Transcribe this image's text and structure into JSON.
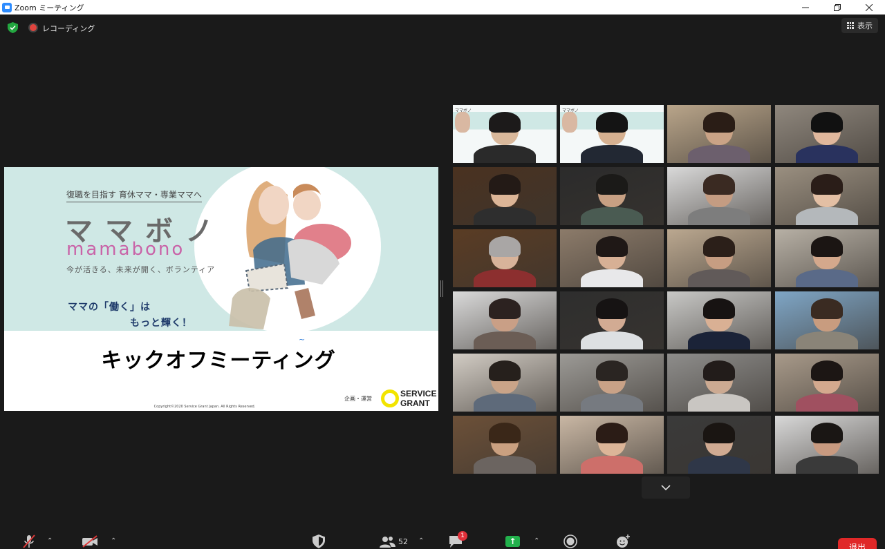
{
  "window": {
    "title": "Zoom ミーティング",
    "controls": [
      "minimize",
      "restore",
      "close"
    ]
  },
  "topbar": {
    "recording_label": "レコーディング",
    "view_label": "表示"
  },
  "slide": {
    "subheading": "復職を目指す 育休ママ・専業ママへ",
    "title_jp": "ママボノ",
    "title_en": "mamabono",
    "tagline": "今が活きる、未来が開く、ボランティア",
    "catch_line1": "ママの「働く」は",
    "catch_line2": "もっと輝く！",
    "main_title": "キックオフミーティング",
    "title_mark": "~",
    "organizer": "企画・運営",
    "logo_line1": "SERVICE",
    "logo_line2": "GRANT",
    "copyright": "Copyright©2020 Service Grant Japan. All Rights Reserved.",
    "corner_label": "ママボノ"
  },
  "participants": {
    "tiles": [
      {
        "bg": "#f4f8f8",
        "skin": "#d9b89b",
        "hair": "#1c1a1a",
        "shirt": "#2a2a2a",
        "branded": true
      },
      {
        "bg": "#f4f8f8",
        "skin": "#d6b191",
        "hair": "#141414",
        "shirt": "#222833",
        "branded": true,
        "active": true
      },
      {
        "bg": "#b9a58a",
        "skin": "#caa386",
        "hair": "#2a1d16",
        "shirt": "#6c5f6d"
      },
      {
        "bg": "#8f877d",
        "skin": "#e0b79c",
        "hair": "#111111",
        "shirt": "#29325e"
      },
      {
        "bg": "#4a3220",
        "skin": "#dcb597",
        "hair": "#231a16",
        "shirt": "#2e2e2e"
      },
      {
        "bg": "#2b2b2b",
        "skin": "#c7a083",
        "hair": "#1b1a18",
        "shirt": "#4a5b52"
      },
      {
        "bg": "#d9d9d9",
        "skin": "#c49c82",
        "hair": "#3a2a22",
        "shirt": "#7d7d7d"
      },
      {
        "bg": "#9a8f80",
        "skin": "#e3bfa4",
        "hair": "#2a1d18",
        "shirt": "#b4b8bb"
      },
      {
        "bg": "#5a3c24",
        "skin": "#d8b39a",
        "hair": "#a9a6a5",
        "shirt": "#8c2f2f"
      },
      {
        "bg": "#8c7b6a",
        "skin": "#d7b095",
        "hair": "#1f1816",
        "shirt": "#e8e8ea"
      },
      {
        "bg": "#bba890",
        "skin": "#c69d82",
        "hair": "#2b1f19",
        "shirt": "#615a59"
      },
      {
        "bg": "#b7b0a5",
        "skin": "#d4a88c",
        "hair": "#1b1513",
        "shirt": "#5a6a88"
      },
      {
        "bg": "#dadada",
        "skin": "#c99f86",
        "hair": "#2c2220",
        "shirt": "#6b5d55"
      },
      {
        "bg": "#2e2e2e",
        "skin": "#d2ab93",
        "hair": "#161313",
        "shirt": "#dde0e2"
      },
      {
        "bg": "#c8c8c6",
        "skin": "#d9b094",
        "hair": "#171312",
        "shirt": "#1b2338"
      },
      {
        "bg": "#7fa6c6",
        "skin": "#c89c7f",
        "hair": "#3a2b22",
        "shirt": "#8a8478"
      },
      {
        "bg": "#d2ccc4",
        "skin": "#caa488",
        "hair": "#26201c",
        "shirt": "#5e6a7a"
      },
      {
        "bg": "#9c9a96",
        "skin": "#c9a287",
        "hair": "#2a2522",
        "shirt": "#767a80"
      },
      {
        "bg": "#8e8d8b",
        "skin": "#ccaa92",
        "hair": "#221c1a",
        "shirt": "#c9c6c2"
      },
      {
        "bg": "#a89a8a",
        "skin": "#d4a98e",
        "hair": "#1c1614",
        "shirt": "#a05060"
      },
      {
        "bg": "#6c5038",
        "skin": "#caa080",
        "hair": "#3a2718",
        "shirt": "#6b6460"
      },
      {
        "bg": "#c9b7a4",
        "skin": "#dcb598",
        "hair": "#2b1c16",
        "shirt": "#cd6f6a"
      },
      {
        "bg": "#3a3a3a",
        "skin": "#d0aa92",
        "hair": "#1a1512",
        "shirt": "#2f3748"
      },
      {
        "bg": "#d8d8d8",
        "skin": "#c89a80",
        "hair": "#1a1614",
        "shirt": "#3a3a3a"
      }
    ]
  },
  "toolbar": {
    "participants_count": "52",
    "chat_badge": "1",
    "leave_label": "退出"
  },
  "colors": {
    "accent": "#2d8cff",
    "active_speaker": "#d7e23a",
    "leave": "#e02828",
    "share": "#22b14c"
  }
}
